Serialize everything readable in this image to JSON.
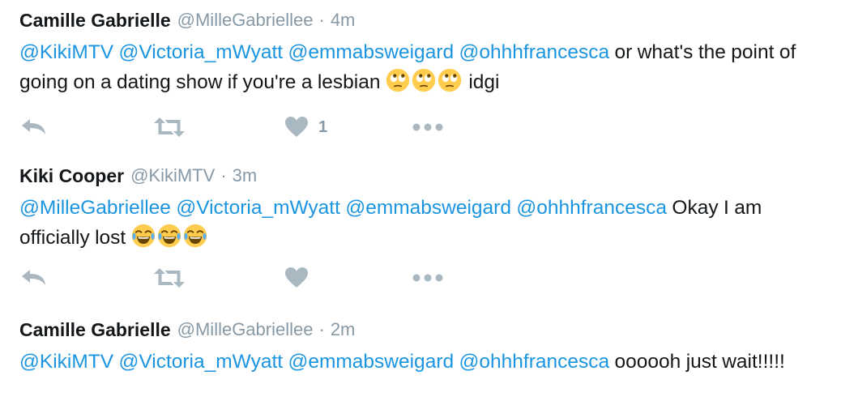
{
  "tweets": [
    {
      "name": "Camille Gabrielle",
      "handle": "@MilleGabriellee",
      "separator": "·",
      "time": "4m",
      "mentions": [
        "@KikiMTV",
        "@Victoria_mWyatt",
        "@emmabsweigard",
        "@ohhhfrancesca"
      ],
      "text": "or what's the point of going on a dating show if you're a lesbian",
      "emoji": "face-with-rolling-eyes",
      "emoji_count": 3,
      "text_after": "idgi",
      "like_count": "1"
    },
    {
      "name": "Kiki Cooper",
      "handle": "@KikiMTV",
      "separator": "·",
      "time": "3m",
      "mentions": [
        "@MilleGabriellee",
        "@Victoria_mWyatt",
        "@emmabsweigard",
        "@ohhhfrancesca"
      ],
      "text": "Okay I am officially lost",
      "emoji": "face-with-tears-of-joy",
      "emoji_count": 3,
      "text_after": ""
    },
    {
      "name": "Camille Gabrielle",
      "handle": "@MilleGabriellee",
      "separator": "·",
      "time": "2m",
      "mentions": [
        "@KikiMTV",
        "@Victoria_mWyatt",
        "@emmabsweigard",
        "@ohhhfrancesca"
      ],
      "text": "oooooh just wait!!!!!"
    }
  ],
  "icons": {
    "reply": "reply-icon",
    "retweet": "retweet-icon",
    "like": "heart-icon",
    "more": "more-icon"
  },
  "colors": {
    "mention": "#1b95e0",
    "meta": "#8899a6",
    "text": "#14171a",
    "action_icon": "#aab8c2"
  }
}
